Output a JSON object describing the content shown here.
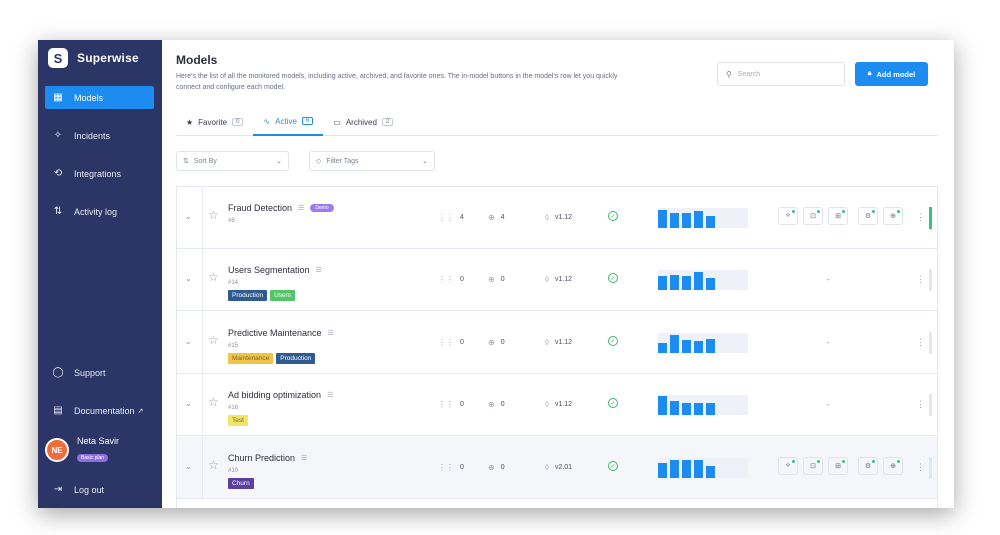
{
  "sidebar": {
    "brand": "Superwise",
    "nav": [
      {
        "label": "Models",
        "icon": "grid-icon",
        "active": true
      },
      {
        "label": "Incidents",
        "icon": "diamond-icon",
        "active": false
      },
      {
        "label": "Integrations",
        "icon": "plug-icon",
        "active": false
      },
      {
        "label": "Activity log",
        "icon": "arrows-icon",
        "active": false
      }
    ],
    "bottom": [
      {
        "label": "Support",
        "icon": "chat-icon"
      },
      {
        "label": "Documentation",
        "icon": "book-icon"
      }
    ],
    "user": {
      "initials": "NE",
      "name": "Neta Savir",
      "plan": "Basic plan"
    },
    "logout": "Log out"
  },
  "header": {
    "title": "Models",
    "description": "Here's the list of all the monitored models, including active, archived, and favorite ones. The in-model buttons in the model's row let you quickly connect and configure each model.",
    "search_placeholder": "Search",
    "add_button": "Add model"
  },
  "tabs": [
    {
      "label": "Favorite",
      "count": "0",
      "icon": "star-icon",
      "active": false
    },
    {
      "label": "Active",
      "count": "6",
      "icon": "pulse-icon",
      "active": true
    },
    {
      "label": "Archived",
      "count": "2",
      "icon": "archive-icon",
      "active": false
    }
  ],
  "filters": {
    "sort": "Sort By",
    "tags": "Filter Tags"
  },
  "colors": {
    "accent": "#1c8cf0",
    "sidebar": "#2b3566",
    "success": "#39b86a"
  },
  "models": [
    {
      "name": "Fraud Detection",
      "badge": "Demo",
      "id": "#8",
      "tags": [],
      "segments": "4",
      "policies": "4",
      "version": "v1.12",
      "bars": [
        0.9,
        0.75,
        0.75,
        0.85,
        0.6
      ],
      "actions": true
    },
    {
      "name": "Users Segmentation",
      "badge": "",
      "id": "#14",
      "tags": [
        {
          "label": "Production",
          "color": "#2f5b8f"
        },
        {
          "label": "Users",
          "color": "#55c46a"
        }
      ],
      "segments": "0",
      "policies": "0",
      "version": "v1.12",
      "bars": [
        0.7,
        0.75,
        0.7,
        0.9,
        0.6
      ],
      "actions": false,
      "empty": "-"
    },
    {
      "name": "Predictive Maintenance",
      "badge": "",
      "id": "#15",
      "tags": [
        {
          "label": "Maintenance",
          "color": "#f0c34a"
        },
        {
          "label": "Production",
          "color": "#2f5b8f"
        }
      ],
      "segments": "0",
      "policies": "0",
      "version": "v1.12",
      "bars": [
        0.5,
        0.9,
        0.65,
        0.6,
        0.7
      ],
      "actions": false,
      "empty": "-"
    },
    {
      "name": "Ad bidding optimization",
      "badge": "",
      "id": "#16",
      "tags": [
        {
          "label": "Test",
          "color": "#f3e46a"
        }
      ],
      "segments": "0",
      "policies": "0",
      "version": "v1.12",
      "bars": [
        0.95,
        0.7,
        0.6,
        0.6,
        0.6
      ],
      "actions": false,
      "empty": "-"
    },
    {
      "name": "Churn Prediction",
      "badge": "",
      "id": "#10",
      "tags": [
        {
          "label": "Churn",
          "color": "#5b3f9e"
        }
      ],
      "segments": "0",
      "policies": "0",
      "version": "v2.01",
      "bars": [
        0.75,
        0.9,
        0.9,
        0.9,
        0.6
      ],
      "actions": true
    }
  ]
}
